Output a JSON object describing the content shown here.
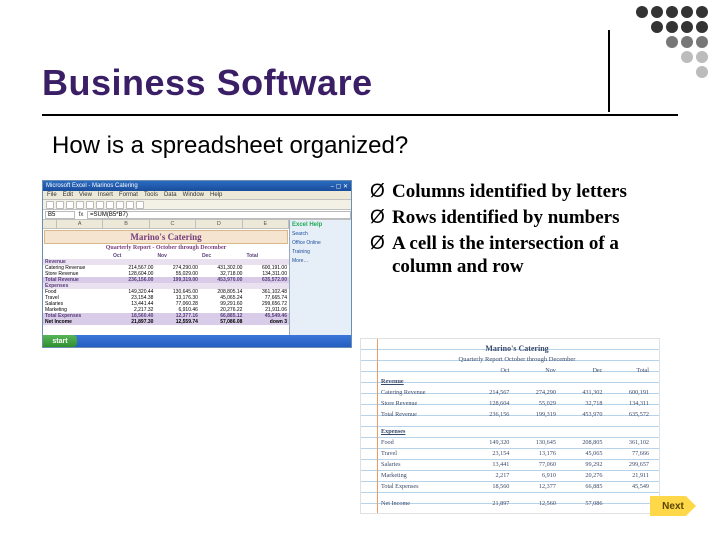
{
  "slide": {
    "title": "Business Software",
    "subtitle": "How is a spreadsheet organized?"
  },
  "bullets": {
    "marker": "Ø",
    "items": [
      "Columns identified by letters",
      "Rows identified by numbers",
      "A cell is the intersection of a column and row"
    ]
  },
  "excel": {
    "window_title": "Microsoft Excel - Marinos Catering",
    "menus": [
      "File",
      "Edit",
      "View",
      "Insert",
      "Format",
      "Tools",
      "Data",
      "Window",
      "Help"
    ],
    "namebox": "B5",
    "formula": "=SUM(B5*B7)",
    "columns": [
      "A",
      "B",
      "C",
      "D",
      "E"
    ],
    "banner_title": "Marino's Catering",
    "banner_sub": "Quarterly Report - October through December",
    "col_headers": [
      "",
      "Oct",
      "Nov",
      "Dec",
      "Total"
    ],
    "section_revenue": "Revenue",
    "rows_revenue": [
      {
        "label": "Catering Revenue",
        "vals": [
          "214,567.00",
          "274,290.00",
          "431,302.00",
          "600,191.00"
        ]
      },
      {
        "label": "Store Revenue",
        "vals": [
          "128,604.00",
          "55,029.00",
          "32,718.00",
          "134,311.00"
        ]
      },
      {
        "label": "Total Revenue",
        "vals": [
          "236,156.00",
          "199,319.00",
          "453,970.00",
          "635,572.00"
        ]
      }
    ],
    "section_expenses": "Expenses",
    "rows_expenses": [
      {
        "label": "Food",
        "vals": [
          "149,320.44",
          "130,645.00",
          "208,805.14",
          "361,102.48"
        ]
      },
      {
        "label": "Travel",
        "vals": [
          "23,154.38",
          "13,176.30",
          "45,065.24",
          "77,665.74"
        ]
      },
      {
        "label": "Salaries",
        "vals": [
          "13,441.44",
          "77,060.28",
          "99,291.60",
          "299,656.72"
        ]
      },
      {
        "label": "Marketing",
        "vals": [
          "2,217.32",
          "6,910.46",
          "20,276.22",
          "21,911.06"
        ]
      },
      {
        "label": "Total Expenses",
        "vals": [
          "18,560.40",
          "12,377.16",
          "66,885.12",
          "45,549.46"
        ]
      }
    ],
    "net_income": {
      "label": "Net Income",
      "vals": [
        "21,897.30",
        "12,559.74",
        "57,086.08",
        "",
        "down 3"
      ]
    },
    "taskpane": {
      "title": "Excel Help",
      "links": [
        "Search",
        "Office Online",
        "Training",
        "More…"
      ]
    },
    "start_label": "start"
  },
  "ledger": {
    "title": "Marino's Catering",
    "subtitle": "Quarterly Report    October through December",
    "col_headers": [
      "",
      "Oct",
      "Nov",
      "Dec",
      "Total"
    ],
    "section_revenue": "Revenue",
    "rows_revenue": [
      {
        "label": "Catering Revenue",
        "vals": [
          "214,567",
          "274,290",
          "431,302",
          "600,191"
        ]
      },
      {
        "label": "Store Revenue",
        "vals": [
          "128,604",
          "55,029",
          "32,718",
          "134,311"
        ]
      },
      {
        "label": "Total Revenue",
        "vals": [
          "236,156",
          "199,319",
          "453,970",
          "635,572"
        ]
      }
    ],
    "section_expenses": "Expenses",
    "rows_expenses": [
      {
        "label": "Food",
        "vals": [
          "149,320",
          "130,645",
          "208,805",
          "361,102"
        ]
      },
      {
        "label": "Travel",
        "vals": [
          "23,154",
          "13,176",
          "45,065",
          "77,666"
        ]
      },
      {
        "label": "Salaries",
        "vals": [
          "13,441",
          "77,060",
          "99,292",
          "299,657"
        ]
      },
      {
        "label": "Marketing",
        "vals": [
          "2,217",
          "6,910",
          "20,276",
          "21,911"
        ]
      },
      {
        "label": "Total Expenses",
        "vals": [
          "18,560",
          "12,377",
          "66,885",
          "45,549"
        ]
      }
    ],
    "net_income": {
      "label": "Net Income",
      "vals": [
        "21,897",
        "12,560",
        "57,086",
        ""
      ]
    }
  },
  "nav": {
    "next_label": "Next"
  }
}
